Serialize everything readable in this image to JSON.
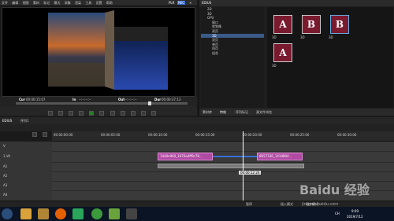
{
  "app": {
    "name": "EDIUS"
  },
  "menu": {
    "items": [
      "文件",
      "编辑",
      "视图",
      "素材",
      "标记",
      "模式",
      "采集",
      "渲染",
      "工具",
      "设置",
      "帮助"
    ],
    "plr_badge": "PLR",
    "rec_badge": "REC"
  },
  "preview": {
    "cur_label": "Cur",
    "cur_value": "00:00:15:07",
    "in_label": "In",
    "in_value": "--:--:--:--",
    "out_label": "Out",
    "out_value": "--:--:--:--",
    "dur_label": "Dur",
    "dur_value": "00:00:37:13"
  },
  "right_panel": {
    "title": "EDIUS",
    "tree": [
      "2D",
      "3D",
      "GPU",
      "窗口",
      "软划像",
      "双页",
      "3D",
      "双页",
      "单页",
      "四页",
      "组合"
    ],
    "thumbs": [
      {
        "label": "3D",
        "letter": "A"
      },
      {
        "label": "3D",
        "letter": "B"
      },
      {
        "label": "3D",
        "letter": "B"
      },
      {
        "label": "3D",
        "letter": "A"
      }
    ],
    "tabs": [
      "素材库",
      "特效",
      "序列标记",
      "源文件浏览"
    ]
  },
  "timeline": {
    "sequence": "序列1",
    "ruler_marks": [
      "00:00:00:00",
      "00:00:05:00",
      "00:00:10:00",
      "00:00:15:00",
      "00:00:20:00",
      "00:00:25:00",
      "00:00:30:00"
    ],
    "tracks": [
      "V",
      "1 VA",
      "A1",
      "A2",
      "A3",
      "A4"
    ],
    "clips": [
      {
        "name": "1440x960_1676a4ff9c78..."
      },
      {
        "name": "8657336_1410804..."
      }
    ],
    "tooltip": "00:00:12:24"
  },
  "status": {
    "text": "暂停",
    "right1": "插入模式",
    "right2": "同步模式"
  },
  "taskbar": {
    "icons": [
      {
        "name": "start",
        "color": "#2a4d7a"
      },
      {
        "name": "explorer",
        "color": "#d9a23a"
      },
      {
        "name": "firefox",
        "color": "#e66000"
      },
      {
        "name": "app3",
        "color": "#2aa55a"
      },
      {
        "name": "app4",
        "color": "#3c9a3c"
      },
      {
        "name": "app5",
        "color": "#6aa23c"
      },
      {
        "name": "app6",
        "color": "#444"
      }
    ],
    "time": "9:09",
    "date": "2019/7/12",
    "ime": "CH"
  },
  "watermark": {
    "text": "Baidu 经验",
    "sub": "jingyan.baidu.com"
  },
  "colors": {
    "clip": "#b04aa2",
    "thumb": "#7a1a2e",
    "taskbar": "#0b1424"
  }
}
